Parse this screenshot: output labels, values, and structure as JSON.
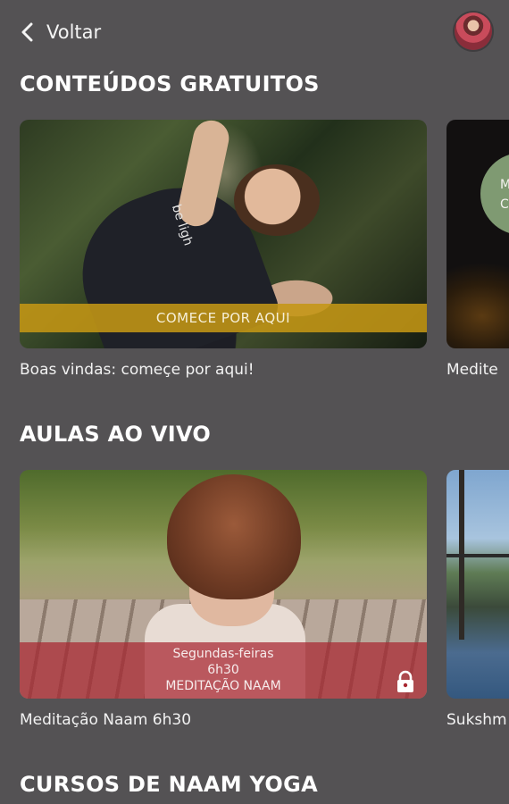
{
  "header": {
    "back_label": "Voltar"
  },
  "sections": [
    {
      "title": "CONTEÚDOS GRATUITOS",
      "cards": [
        {
          "banner": "COMECE POR AQUI",
          "shirt_text": "be ligh",
          "caption": "Boas vindas: começe por aqui!"
        },
        {
          "circle_text": [
            "M",
            "C"
          ],
          "caption": "Medite"
        }
      ]
    },
    {
      "title": "AULAS AO VIVO",
      "cards": [
        {
          "banner_lines": [
            "Segundas-feiras",
            "6h30",
            "MEDITAÇÃO NAAM"
          ],
          "caption": "Meditação Naam 6h30",
          "locked": true
        },
        {
          "caption": "Sukshm"
        }
      ]
    },
    {
      "title": "CURSOS DE NAAM YOGA"
    }
  ],
  "colors": {
    "background": "#545254",
    "gold_banner": "#c49614",
    "red_banner": "#a82630",
    "peek_circle": "#7f9a72"
  },
  "icons": {
    "back": "chevron-left-icon",
    "lock": "lock-icon"
  }
}
